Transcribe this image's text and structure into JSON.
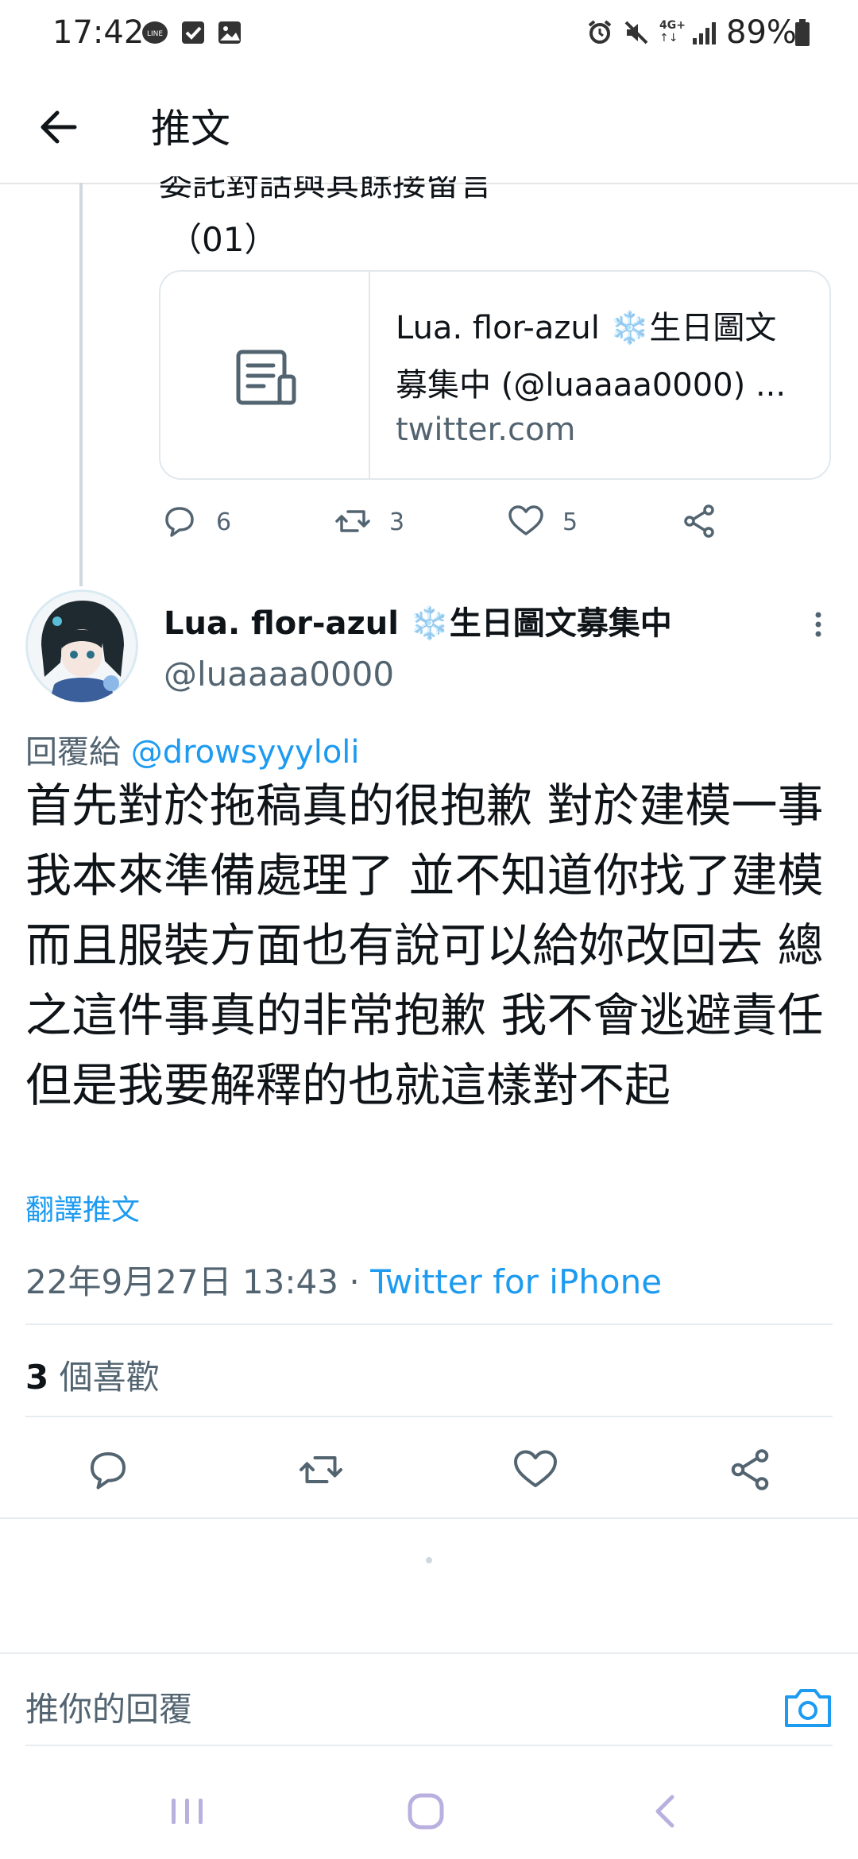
{
  "status_bar": {
    "time": "17:42",
    "battery": "89%",
    "network": "4G+"
  },
  "header": {
    "title": "推文"
  },
  "previous_tweet": {
    "text_cut": "委託對話與其餘接留言",
    "text_line2": "（01）",
    "card": {
      "title_line1": "Lua. flor-azul ❄️生日圖文",
      "title_line2": "募集中 (@luaaaa0000) ...",
      "domain": "twitter.com"
    },
    "actions": {
      "reply_count": "6",
      "retweet_count": "3",
      "like_count": "5"
    }
  },
  "tweet": {
    "author_name": "Lua. flor-azul ❄️生日圖文募集中",
    "handle": "@luaaaa0000",
    "reply_to_label": "回覆給",
    "reply_to_handle": "@drowsyyyloli",
    "body": "首先對於拖稿真的很抱歉 對於建模一事我本來準備處理了 並不知道你找了建模 而且服裝方面也有說可以給妳改回去 總之這件事真的非常抱歉 我不會逃避責任 但是我要解釋的也就這樣對不起",
    "translate_label": "翻譯推文",
    "timestamp": "22年9月27日 13:43",
    "separator": " · ",
    "source": "Twitter for iPhone",
    "likes_count": "3",
    "likes_label": " 個喜歡"
  },
  "reply_bar": {
    "placeholder": "推你的回覆"
  },
  "colors": {
    "accent": "#1d9bf0",
    "secondary_text": "#536471",
    "divider": "#e6ecf0"
  }
}
